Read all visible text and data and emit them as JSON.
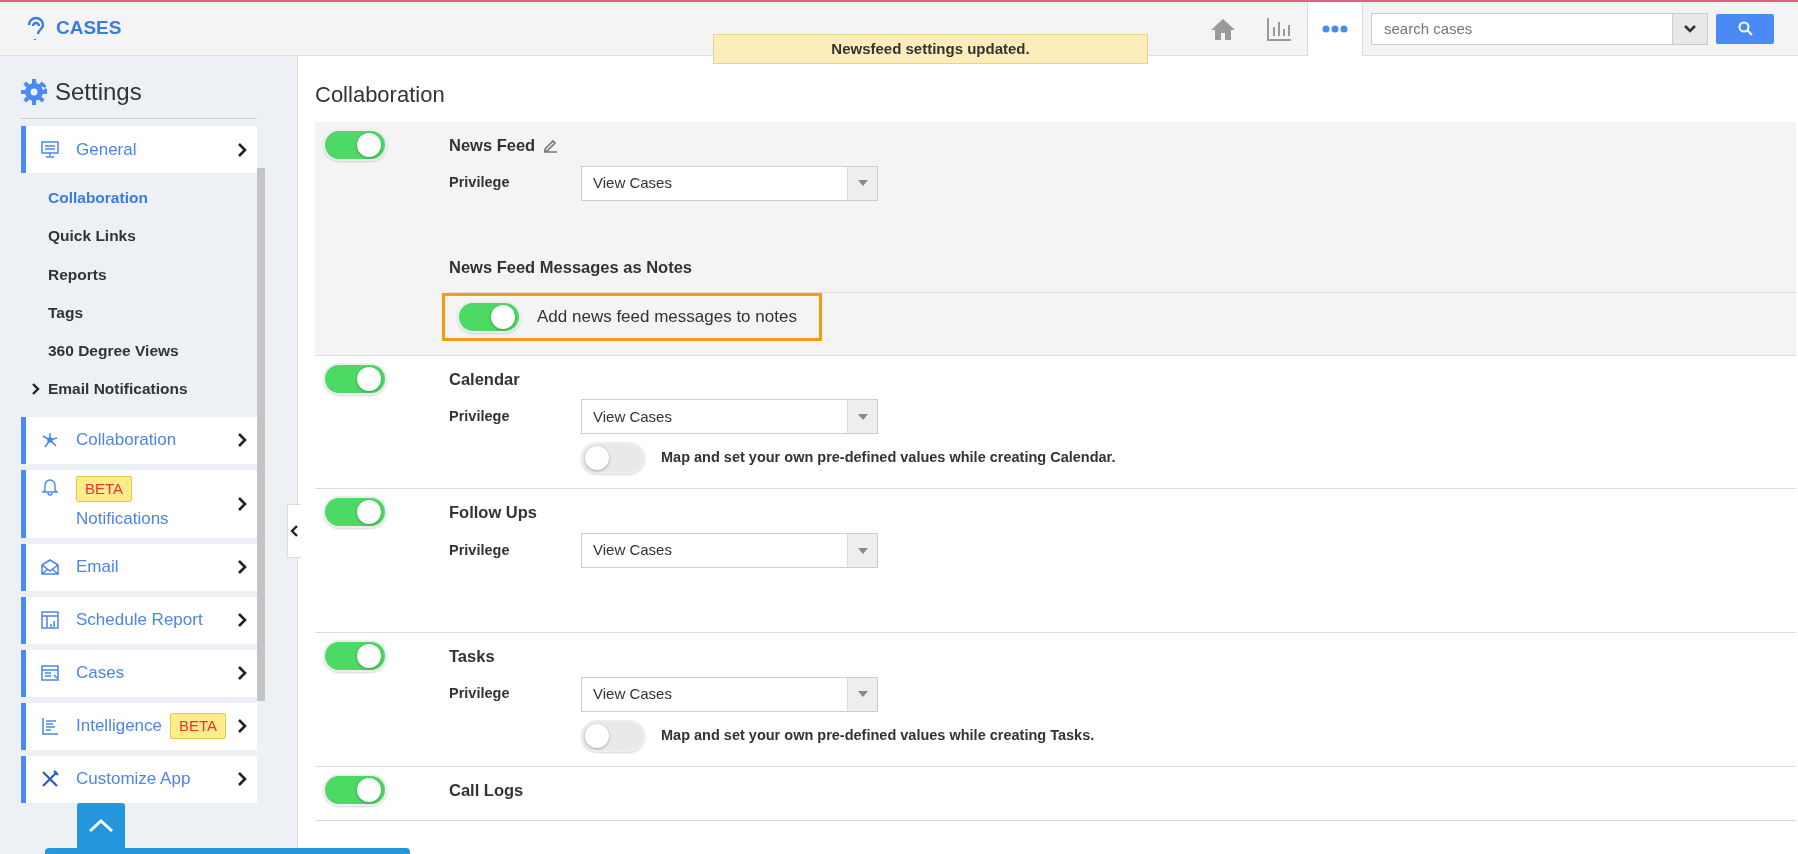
{
  "header": {
    "logo_text": "CASES",
    "toast": "Newsfeed settings updated.",
    "search": {
      "placeholder": "search cases"
    }
  },
  "sidebar": {
    "title": "Settings",
    "items": [
      {
        "label": "General",
        "children": [
          {
            "label": "Collaboration",
            "selected": true,
            "kind": "link"
          },
          {
            "label": "Quick Links",
            "selected": false,
            "kind": "link"
          },
          {
            "label": "Reports",
            "selected": false,
            "kind": "link"
          },
          {
            "label": "Tags",
            "selected": false,
            "kind": "link"
          },
          {
            "label": "360 Degree Views",
            "selected": false,
            "kind": "link"
          },
          {
            "label": "Email Notifications",
            "selected": false,
            "kind": "group"
          }
        ]
      },
      {
        "label": "Collaboration"
      },
      {
        "label": "Notifications",
        "badge": "BETA",
        "badge_above": true
      },
      {
        "label": "Email"
      },
      {
        "label": "Schedule Report"
      },
      {
        "label": "Cases"
      },
      {
        "label": "Intelligence",
        "badge": "BETA",
        "badge_above": false
      },
      {
        "label": "Customize App"
      }
    ]
  },
  "page_title": "Collaboration",
  "sections": [
    {
      "title": "News Feed",
      "enabled": true,
      "editable": true,
      "privilege_label": "Privilege",
      "privilege_value": "View Cases",
      "notes": {
        "heading": "News Feed Messages as Notes",
        "on": true,
        "text": "Add news feed messages to notes",
        "highlighted": true
      }
    },
    {
      "title": "Calendar",
      "enabled": true,
      "editable": false,
      "privilege_label": "Privilege",
      "privilege_value": "View Cases",
      "map": {
        "on": false,
        "text": "Map and set your own pre-defined values while creating Calendar."
      }
    },
    {
      "title": "Follow Ups",
      "enabled": true,
      "editable": false,
      "privilege_label": "Privilege",
      "privilege_value": "View Cases"
    },
    {
      "title": "Tasks",
      "enabled": true,
      "editable": false,
      "privilege_label": "Privilege",
      "privilege_value": "View Cases",
      "map": {
        "on": false,
        "text": "Map and set your own pre-defined values while creating Tasks."
      }
    },
    {
      "title": "Call Logs",
      "enabled": true,
      "editable": false
    }
  ]
}
